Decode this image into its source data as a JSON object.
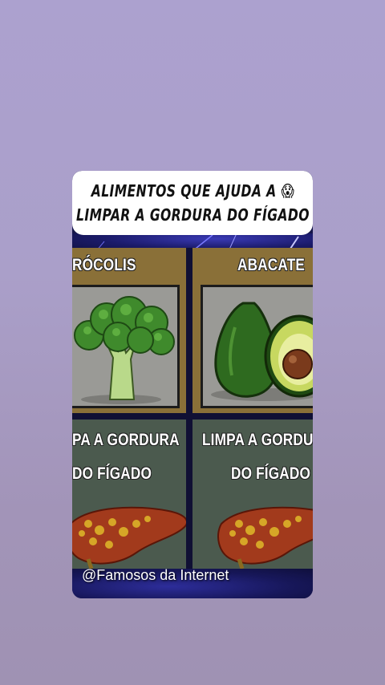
{
  "post": {
    "title_line1": "ALIMENTOS QUE AJUDA A",
    "title_emoji": "😱",
    "title_line2": "LIMPAR A GORDURA DO FÍGADO",
    "watermark": "@Famosos da Internet"
  },
  "panels": [
    {
      "label": "RÓCOLIS",
      "image_icon": "broccoli-icon"
    },
    {
      "label": "ABACATE",
      "image_icon": "avocado-icon"
    },
    {
      "label_line1": "PA A GORDURA",
      "label_line2": "DO FÍGADO",
      "image_icon": "liver-icon"
    },
    {
      "label_line1": "LIMPA A GORDU",
      "label_line2": "DO FÍGADO",
      "image_icon": "liver-icon"
    }
  ],
  "colors": {
    "background": "#aca1cf",
    "panel_brown": "#8a7038",
    "panel_green_gray": "#4b5a4e",
    "band_navy": "#16164a"
  }
}
